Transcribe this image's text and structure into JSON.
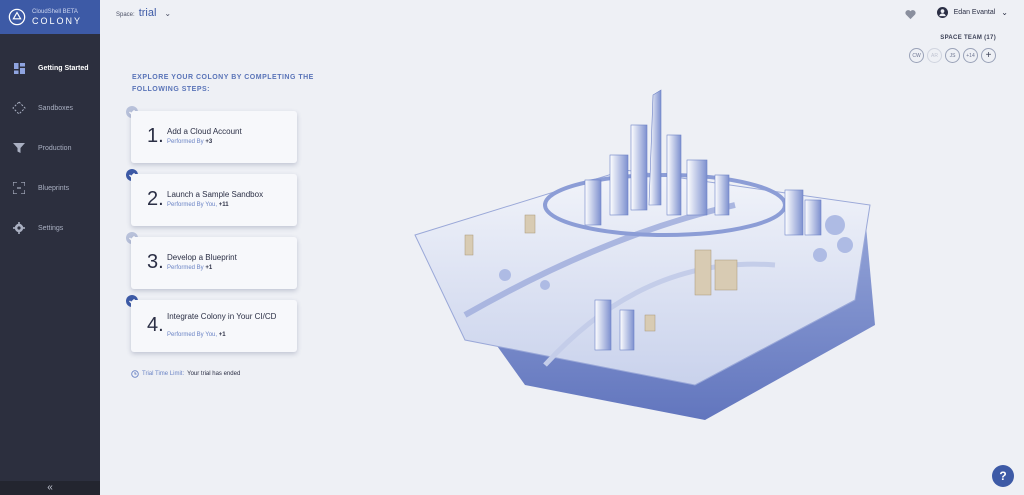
{
  "brand": {
    "sub": "CloudShell BETA",
    "name": "COLONY"
  },
  "sidebar": {
    "items": [
      {
        "label": "Getting Started",
        "icon": "dashboard-icon"
      },
      {
        "label": "Sandboxes",
        "icon": "sandbox-icon"
      },
      {
        "label": "Production",
        "icon": "funnel-icon"
      },
      {
        "label": "Blueprints",
        "icon": "blueprint-icon"
      },
      {
        "label": "Settings",
        "icon": "gear-icon"
      }
    ],
    "collapse_label": "«"
  },
  "topbar": {
    "space_label": "Space:",
    "space_value": "trial",
    "user_name": "Edan Evantal"
  },
  "team": {
    "title": "SPACE TEAM (17)",
    "avatars": [
      "CW",
      "AR",
      "JS",
      "+14",
      "+"
    ]
  },
  "intro": "EXPLORE YOUR COLONY BY COMPLETING THE FOLLOWING STEPS:",
  "steps": [
    {
      "num": "1.",
      "title": "Add a Cloud Account",
      "performed": "Performed By",
      "count": "+3",
      "done": false
    },
    {
      "num": "2.",
      "title": "Launch a Sample Sandbox",
      "performed": "Performed By You,",
      "count": "+11",
      "done": true
    },
    {
      "num": "3.",
      "title": "Develop a Blueprint",
      "performed": "Performed By",
      "count": "+1",
      "done": false
    },
    {
      "num": "4.",
      "title": "Integrate Colony in Your CI/CD",
      "performed": "Performed By You,",
      "count": "+1",
      "done": true
    }
  ],
  "trial": {
    "link": "Trial Time Limit:",
    "status": "Your trial has ended"
  },
  "help_label": "?",
  "colors": {
    "accent": "#3d5aa6",
    "sidebar": "#2c2f3e",
    "background": "#eef0f5"
  }
}
